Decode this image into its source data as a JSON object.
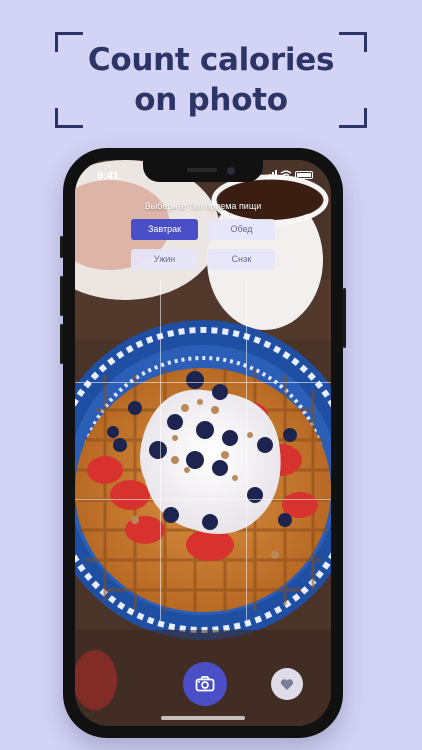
{
  "headline": {
    "line1": "Count calories",
    "line2": "on photo"
  },
  "status_bar": {
    "time": "9:41"
  },
  "meal_picker": {
    "prompt": "Выберите тип приема пищи",
    "options": [
      {
        "label": "Завтрак",
        "selected": true
      },
      {
        "label": "Обед",
        "selected": false
      },
      {
        "label": "Ужин",
        "selected": false
      },
      {
        "label": "Снэк",
        "selected": false
      }
    ]
  },
  "colors": {
    "background": "#d3d3f5",
    "headline": "#2c3566",
    "accent": "#4b4fc7"
  },
  "icons": {
    "capture": "camera-icon",
    "favorite": "heart-icon"
  }
}
